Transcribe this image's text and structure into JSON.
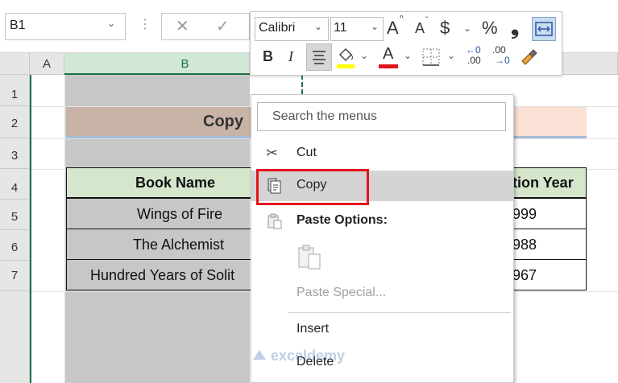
{
  "namebox": {
    "value": "B1",
    "arrow": "⌄"
  },
  "formula_bar": {
    "dots": "⋮",
    "cancel": "✕",
    "confirm": "✓"
  },
  "columns": [
    "A",
    "B"
  ],
  "rows": [
    "1",
    "2",
    "3",
    "4",
    "5",
    "6",
    "7"
  ],
  "sheet": {
    "title_fragment": "Copy",
    "header": {
      "book_name": "Book Name",
      "year_fragment": "tion Year"
    },
    "books": [
      {
        "name": "Wings of Fire",
        "year": "999"
      },
      {
        "name": "The Alchemist",
        "year": "988"
      },
      {
        "name": "Hundred Years of Solit",
        "year": "967"
      }
    ],
    "colors": {
      "title_left": "#c8b3a7",
      "title_right": "#fbe0d5",
      "header_fill": "#d6e6cd",
      "selection_fill": "#c7c7c7",
      "selection_border": "#1e7145"
    }
  },
  "mini_toolbar": {
    "font": "Calibri",
    "size": "11",
    "grow": "A",
    "shrink": "A",
    "currency": "$",
    "percent": "%",
    "comma": "❟",
    "bold": "B",
    "italic": "I",
    "font_color_letter": "A",
    "inc_decimal": ".00",
    "dec_decimal": ".00",
    "colors": {
      "highlight": "#ffff00",
      "font": "#e0141d"
    }
  },
  "context_menu": {
    "search_placeholder": "Search the menus",
    "cut": "Cut",
    "copy": "Copy",
    "paste_options": "Paste Options:",
    "paste_special": "Paste Special...",
    "insert": "Insert",
    "delete": "Delete",
    "highlight_color": "#e0141d"
  },
  "watermark": {
    "brand": "exceldemy"
  }
}
